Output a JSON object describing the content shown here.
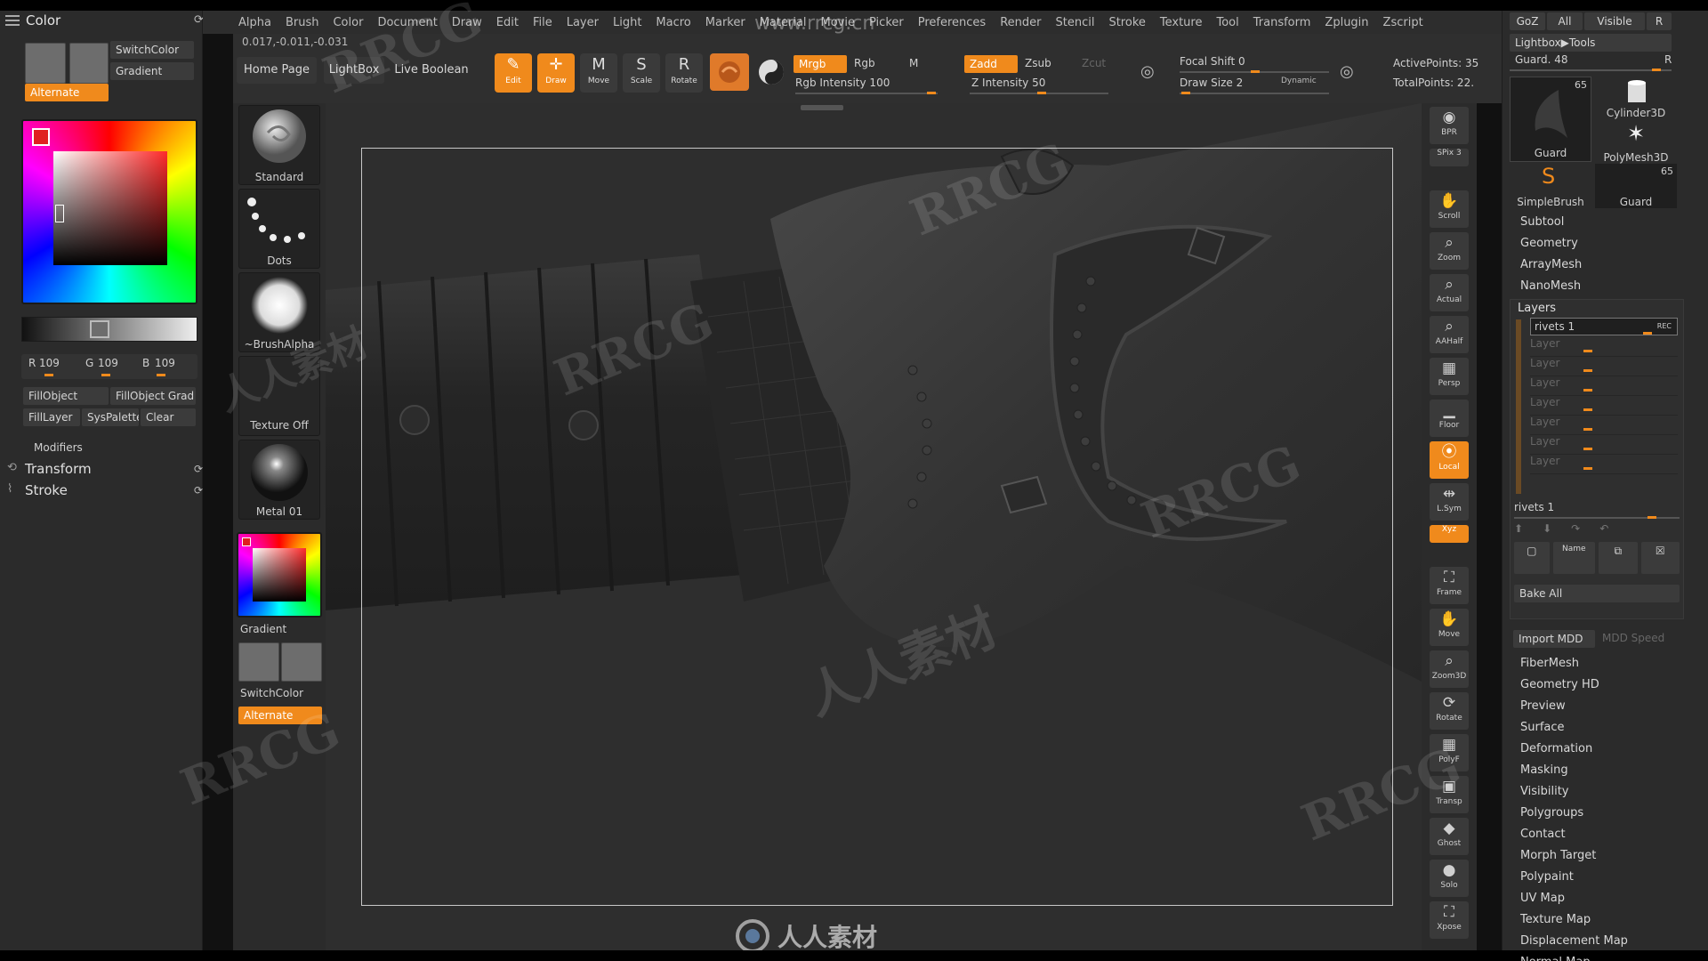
{
  "app": {
    "watermark_url": "www.rrcg.cn",
    "watermark_text": "RRCG",
    "watermark_cn": "人人素材",
    "bottom_logo": "人人素材"
  },
  "left_panel": {
    "title": "Color",
    "switch_color": "SwitchColor",
    "gradient": "Gradient",
    "alternate": "Alternate",
    "rgb": {
      "r_label": "R",
      "r": "109",
      "g_label": "G",
      "g": "109",
      "b_label": "B",
      "b": "109"
    },
    "buttons": [
      "FillObject",
      "FillObject Grad",
      "FillLayer",
      "SysPalette",
      "Clear"
    ],
    "modifiers_label": "Modifiers",
    "sections": [
      "Transform",
      "Stroke"
    ]
  },
  "menu": {
    "items": [
      "Alpha",
      "Brush",
      "Color",
      "Document",
      "Draw",
      "Edit",
      "File",
      "Layer",
      "Light",
      "Macro",
      "Marker",
      "Material",
      "Movie",
      "Picker",
      "Preferences",
      "Render",
      "Stencil",
      "Stroke",
      "Texture",
      "Tool",
      "Transform",
      "Zplugin",
      "Zscript"
    ]
  },
  "shelf": {
    "coords": "0.017,-0.011,-0.031",
    "tabs": [
      "Home Page",
      "LightBox",
      "Live Boolean"
    ],
    "tools": [
      {
        "label": "Edit",
        "glyph": "✎",
        "active": true
      },
      {
        "label": "Draw",
        "glyph": "✛",
        "active": true
      },
      {
        "label": "Move",
        "glyph": "M",
        "active": false
      },
      {
        "label": "Scale",
        "glyph": "S",
        "active": false
      },
      {
        "label": "Rotate",
        "glyph": "R",
        "active": false
      }
    ],
    "mrgb": "Mrgb",
    "rgb": "Rgb",
    "m": "M",
    "rgb_intensity": "Rgb Intensity 100",
    "zadd": "Zadd",
    "zsub": "Zsub",
    "zcut": "Zcut",
    "z_intensity": "Z Intensity 50",
    "focal_shift": "Focal Shift 0",
    "draw_size": "Draw Size 2",
    "dynamic": "Dynamic",
    "active_points": "ActivePoints: 35",
    "total_points": "TotalPoints: 22."
  },
  "brushes": {
    "items": [
      "Standard",
      "Dots",
      "~BrushAlpha",
      "Texture Off",
      "Metal 01"
    ],
    "gradient": "Gradient",
    "switch_color": "SwitchColor",
    "alternate": "Alternate"
  },
  "right_strip": {
    "items": [
      {
        "label": "BPR",
        "glyph": "◉",
        "active": false
      },
      {
        "label": "SPix 3",
        "glyph": "",
        "active": false
      },
      {
        "label": "Scroll",
        "glyph": "✋",
        "active": false
      },
      {
        "label": "Zoom",
        "glyph": "⌕",
        "active": false
      },
      {
        "label": "Actual",
        "glyph": "⌕",
        "active": false
      },
      {
        "label": "AAHalf",
        "glyph": "⌕",
        "active": false
      },
      {
        "label": "Persp",
        "glyph": "▦",
        "active": false
      },
      {
        "label": "Floor",
        "glyph": "▁",
        "active": false
      },
      {
        "label": "Local",
        "glyph": "⦿",
        "active": true
      },
      {
        "label": "L.Sym",
        "glyph": "⇹",
        "active": false
      },
      {
        "label": "Xyz",
        "glyph": "",
        "active": true
      },
      {
        "label": "Frame",
        "glyph": "⛶",
        "active": false
      },
      {
        "label": "Move",
        "glyph": "✋",
        "active": false
      },
      {
        "label": "Zoom3D",
        "glyph": "⌕",
        "active": false
      },
      {
        "label": "Rotate",
        "glyph": "⟳",
        "active": false
      },
      {
        "label": "PolyF",
        "glyph": "▦",
        "active": false
      },
      {
        "label": "Transp",
        "glyph": "▣",
        "active": false
      },
      {
        "label": "Ghost",
        "glyph": "◆",
        "active": false
      },
      {
        "label": "Solo",
        "glyph": "●",
        "active": false
      },
      {
        "label": "Xpose",
        "glyph": "⛶",
        "active": false
      }
    ]
  },
  "right_panel": {
    "top_buttons": [
      "GoZ",
      "All",
      "Visible",
      "R"
    ],
    "lightbox_tools": "Lightbox▶Tools",
    "guard_label": "Guard. 48",
    "guard_r": "R",
    "thumbs": [
      {
        "label": "Guard",
        "count": "65"
      },
      {
        "label": "Cylinder3D",
        "count": ""
      },
      {
        "label": "PolyMesh3D",
        "count": ""
      },
      {
        "label": "SimpleBrush",
        "count": ""
      },
      {
        "label": "Guard",
        "count": "65"
      }
    ],
    "menu_top": [
      "Subtool",
      "Geometry",
      "ArrayMesh",
      "NanoMesh"
    ],
    "layers_title": "Layers",
    "layer_active": "rivets 1",
    "rec": "REC",
    "layer_rows": [
      "Layer",
      "Layer",
      "Layer",
      "Layer",
      "Layer",
      "Layer",
      "Layer"
    ],
    "rivets_slider": "rivets 1",
    "name_btn": "Name",
    "bake_all": "Bake All",
    "import_mdd": "Import MDD",
    "mdd_speed": "MDD Speed",
    "menu_bottom": [
      "FiberMesh",
      "Geometry HD",
      "Preview",
      "Surface",
      "Deformation",
      "Masking",
      "Visibility",
      "Polygroups",
      "Contact",
      "Morph Target",
      "Polypaint",
      "UV Map",
      "Texture Map",
      "Displacement Map",
      "Normal Map"
    ]
  },
  "colors": {
    "accent": "#f08a1c",
    "panel": "#2b2b2b",
    "canvas": "#2e2e2e"
  }
}
